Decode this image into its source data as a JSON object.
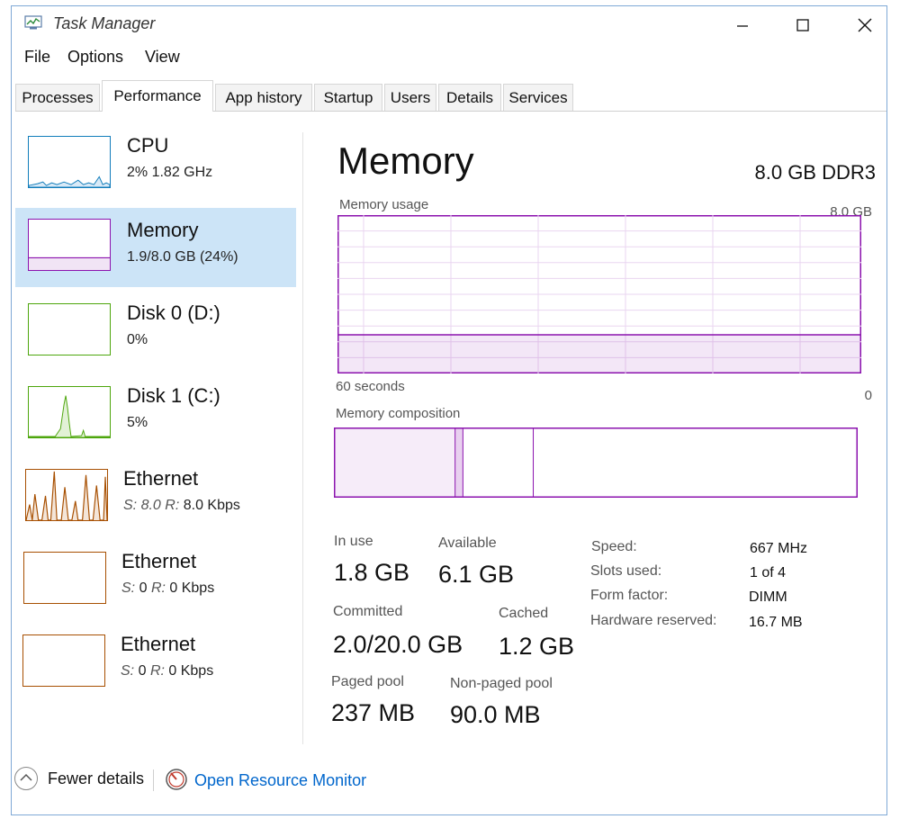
{
  "window": {
    "title": "Task Manager"
  },
  "menu": [
    "File",
    "Options",
    "View"
  ],
  "tabs": [
    {
      "label": "Processes",
      "active": false
    },
    {
      "label": "Performance",
      "active": true
    },
    {
      "label": "App history",
      "active": false
    },
    {
      "label": "Startup",
      "active": false
    },
    {
      "label": "Users",
      "active": false
    },
    {
      "label": "Details",
      "active": false
    },
    {
      "label": "Services",
      "active": false
    }
  ],
  "sidebar": [
    {
      "title": "CPU",
      "subtitle": "2%  1.82 GHz",
      "color": "#117dbb",
      "selected": false
    },
    {
      "title": "Memory",
      "subtitle": "1.9/8.0 GB (24%)",
      "color": "#8b12ae",
      "selected": true
    },
    {
      "title": "Disk 0 (D:)",
      "subtitle": "0%",
      "color": "#4da60c",
      "selected": false
    },
    {
      "title": "Disk 1 (C:)",
      "subtitle": "5%",
      "color": "#4da60c",
      "selected": false
    },
    {
      "title": "Ethernet",
      "send_label": "S:",
      "send": "8.0",
      "recv_label": "R:",
      "recv": "8.0 Kbps",
      "color": "#a74f01",
      "selected": false
    },
    {
      "title": "Ethernet",
      "send_label": "S:",
      "send": "0",
      "recv_label": "R:",
      "recv": "0 Kbps",
      "color": "#a74f01",
      "selected": false
    },
    {
      "title": "Ethernet",
      "send_label": "S:",
      "send": "0",
      "recv_label": "R:",
      "recv": "0 Kbps",
      "color": "#a74f01",
      "selected": false
    }
  ],
  "detail": {
    "title": "Memory",
    "spec": "8.0 GB DDR3",
    "usage_label": "Memory usage",
    "usage_max": "8.0 GB",
    "time_label": "60 seconds",
    "zero_label": "0",
    "composition_label": "Memory composition",
    "usage_fraction": 0.24,
    "composition": {
      "in_use_fraction": 0.23,
      "modified_fraction": 0.015,
      "standby_fraction": 0.135
    },
    "stats": {
      "in_use": {
        "label": "In use",
        "value": "1.8 GB"
      },
      "available": {
        "label": "Available",
        "value": "6.1 GB"
      },
      "committed": {
        "label": "Committed",
        "value": "2.0/20.0 GB"
      },
      "cached": {
        "label": "Cached",
        "value": "1.2 GB"
      },
      "paged_pool": {
        "label": "Paged pool",
        "value": "237 MB"
      },
      "nonpaged_pool": {
        "label": "Non-paged pool",
        "value": "90.0 MB"
      }
    },
    "specs": {
      "speed": {
        "label": "Speed:",
        "value": "667 MHz"
      },
      "slots": {
        "label": "Slots used:",
        "value": "1 of 4"
      },
      "form": {
        "label": "Form factor:",
        "value": "DIMM"
      },
      "reserved": {
        "label": "Hardware reserved:",
        "value": "16.7 MB"
      }
    }
  },
  "footer": {
    "fewer_details": "Fewer details",
    "resource_monitor": "Open Resource Monitor"
  },
  "colors": {
    "memory": "#8b12ae",
    "link": "#0066cc",
    "selection": "#cce4f7"
  }
}
